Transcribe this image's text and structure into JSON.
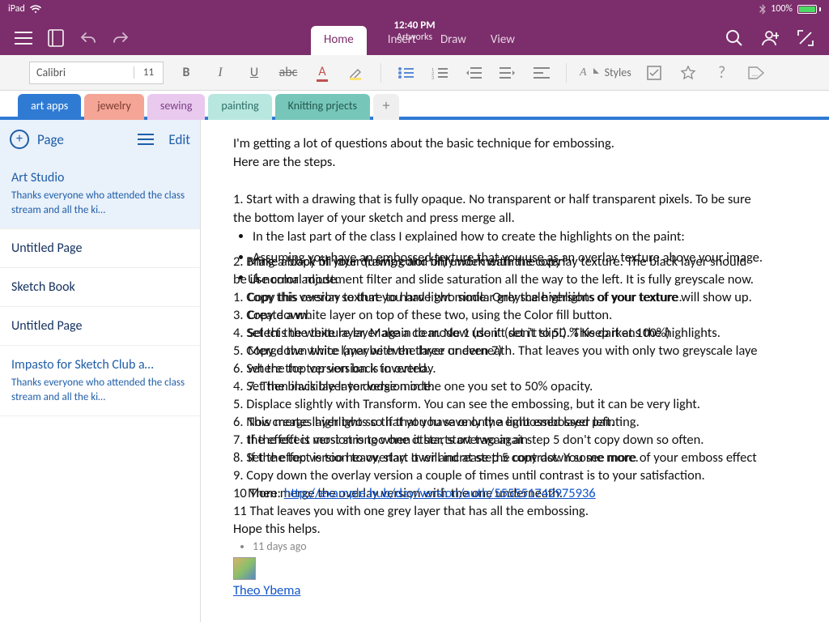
{
  "status": {
    "device": "iPad",
    "time": "12:40 PM",
    "battery": "100%"
  },
  "doc": {
    "name": "Artworks"
  },
  "ribbon": {
    "tabs": [
      "Home",
      "Insert",
      "Draw",
      "View"
    ],
    "active": 0
  },
  "font": {
    "name": "Calibri",
    "size": "11"
  },
  "fmt": {
    "styles": "Styles"
  },
  "sections": [
    {
      "label": "art apps",
      "color": "#2f7bd4",
      "active": true,
      "text": "#ffffff"
    },
    {
      "label": "jewelry",
      "color": "#f5a596",
      "text": "#7a3a2f"
    },
    {
      "label": "sewing",
      "color": "#e9c9ee",
      "text": "#7a3f86"
    },
    {
      "label": "painting",
      "color": "#b8e7e0",
      "text": "#2b6e66"
    },
    {
      "label": "Knitting prjects",
      "color": "#76c7b9",
      "text": "#25574f"
    }
  ],
  "pagelist": {
    "header": {
      "page": "Page",
      "edit": "Edit"
    },
    "items": [
      {
        "title": "Art Studio",
        "sub": "Thanks everyone who attended the class stream and all the ki…",
        "selected": true,
        "blue": true
      },
      {
        "title": "Untitled Page"
      },
      {
        "title": "Sketch Book"
      },
      {
        "title": "Untitled Page"
      },
      {
        "title": "Impasto for Sketch Club a…",
        "sub": "Thanks everyone who attended the class stream and all the ki…",
        "blue": true
      }
    ]
  },
  "content": {
    "layer1": [
      "I'm getting a lot of questions about the basic technique for embossing.",
      "Here are the steps.",
      "",
      "1. Start with a drawing that is fully opaque. No transparent or half transparent pixels. To be sure",
      "the bottom layer of your sketch and press merge all."
    ],
    "bullets1": [
      "In the last part of the class I explained how to create the highlights on the paint:",
      "Assuming you have an embossed texture that you use as an overlay texture above your image."
    ],
    "bullet_merge_head": "1.",
    "layer2_lines": [
      "2. Bring a black fill layer (using color fill) underneath the overlay texture. The black layer should",
      "be in normal mode.",
      "1. Copy this version so that you have two similar greyscale versions of your texture.",
      "3. Copy down.",
      "4. Set this the texture layer again to mode 1 (don't set it to 50 % Keep it at 100%)",
      "5. Copy down twice (maybe even three or even 7)",
      "6. Set the top version back to overlay.",
      "4. Set the black layer to dodge mode.",
      "5. Displace slightly with Transform. You can see the embossing, but it can be very light.",
      "6. Now merge layer two so that you have only the embossed layer left.",
      "7. the effect is most strong when it starts overagain at step 5 don't copy down so often.",
      "8. Set the top version to overlay. It will increase the contrast. You see more of your emboss effect",
      "9. Copy down the overlay version a couple of times until contrast is to your satisfaction.",
      "10 Then merge the overlay version with the one underneath.",
      "11 That leaves you with one grey layer that has all the embossing.",
      "Hope this helps."
    ],
    "layer2_overlap": [
      "Make a copy of your drawing and only work with the copy",
      "Use color adjustment filter and slide saturation all the way to the left. It is fully greyscale now.",
      "Copy this overlay texture to hard light mode. Only the highlights of your texture will show up.",
      "Create a white layer on top of these two, using the Color fill button.",
      "Select the white layer. Make a clear. Now use it (don't slip!). This darkens the highlights.",
      "Merge the white layer with the layer underneath. That leaves you with only two greyscale laye",
      "where the top version is inverted.",
      "7. Then invisible layer version in the one you set to 50% opacity.",
      "",
      "This creates highlights so if that you save only a light embossed painting.",
      "If the effect version is too one other, start two again",
      "If the effect is too heavy, start over and at step 5 copy down some more.",
      "",
      "More: http://example.hub/day/version/auth/555551742975936"
    ],
    "meta_time": "11 days ago",
    "author": "Theo Ybema"
  }
}
